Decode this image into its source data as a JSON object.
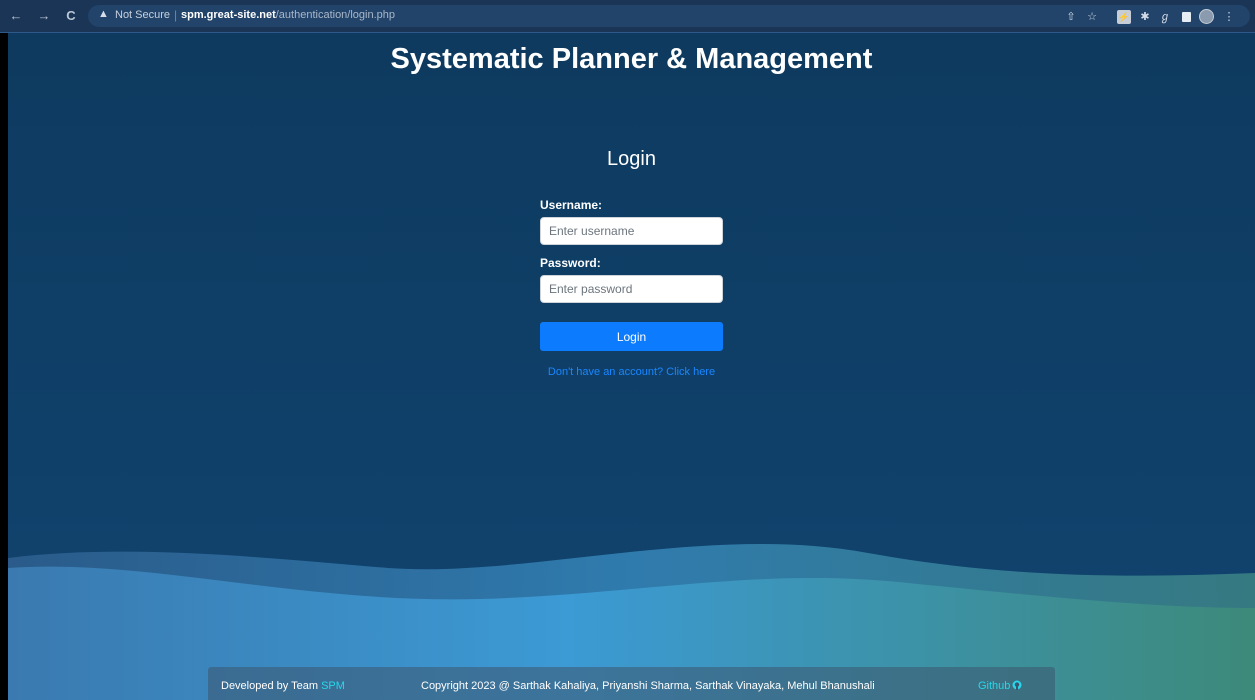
{
  "browser": {
    "back_icon": "←",
    "forward_icon": "→",
    "reload_icon": "C",
    "security_icon": "▲",
    "security_label": "Not Secure",
    "url_host": "spm.great-site.net",
    "url_path": "/authentication/login.php"
  },
  "page": {
    "site_title": "Systematic Planner & Management",
    "login_heading": "Login",
    "username_label": "Username:",
    "username_placeholder": "Enter username",
    "username_value": "",
    "password_label": "Password:",
    "password_placeholder": "Enter password",
    "password_value": "",
    "login_button": "Login",
    "register_link": "Don't have an account? Click here"
  },
  "footer": {
    "developed_by": "Developed by Team ",
    "team": "SPM",
    "copyright": "Copyright 2023 @ Sarthak Kahaliya, Priyanshi Sharma, Sarthak Vinayaka, Mehul Bhanushali",
    "github": "Github"
  },
  "colors": {
    "background": "#0e3a5f",
    "primary_button": "#0d7bfe",
    "link": "#1a86ff",
    "accent": "#26d7ea"
  }
}
